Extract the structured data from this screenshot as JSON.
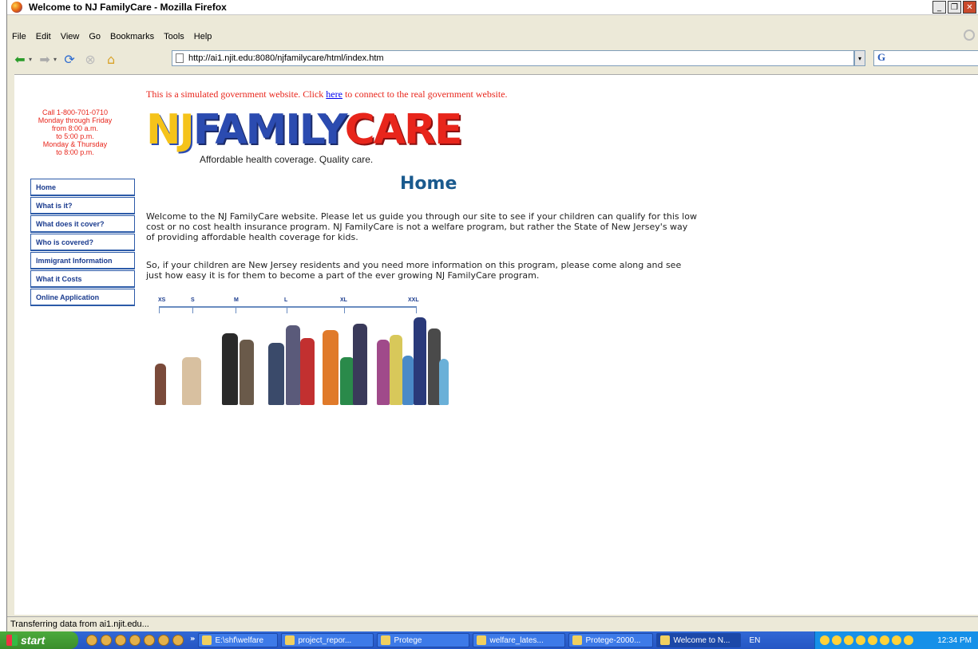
{
  "window": {
    "title": "Welcome to NJ FamilyCare - Mozilla Firefox"
  },
  "menu": [
    "File",
    "Edit",
    "View",
    "Go",
    "Bookmarks",
    "Tools",
    "Help"
  ],
  "nav": {
    "url": "http://ai1.njit.edu:8080/njfamilycare/html/index.htm"
  },
  "page": {
    "notice_before": "This is a simulated government website. Click ",
    "notice_link": "here",
    "notice_after": " to connect to the real government website.",
    "call_lines": [
      "Call 1-800-701-0710",
      "Monday through Friday",
      "from 8:00 a.m.",
      "to 5:00 p.m.",
      "Monday & Thursday",
      "to 8:00 p.m."
    ],
    "logo": {
      "nj": "NJ",
      "family": "FAMILY",
      "care": "CARE",
      "tagline": "Affordable health coverage. Quality care."
    },
    "sidebar": [
      "Home",
      "What is it?",
      "What does it cover?",
      "Who is covered?",
      "Immigrant Information",
      "What it Costs",
      "Online Application"
    ],
    "heading": "Home",
    "para1": "Welcome to the NJ FamilyCare website. Please let us guide you through our site to see if your children can qualify for this low cost or no cost health insurance program. NJ FamilyCare is not a welfare program, but rather the State of New Jersey's way of providing affordable health coverage for kids.",
    "para2": "So, if your children are New Jersey residents and you need more information on this program, please come along and see just how easy it is for them to become a part of the ever growing NJ FamilyCare program.",
    "sizes": [
      "XS",
      "S",
      "M",
      "L",
      "XL",
      "XXL"
    ]
  },
  "status": "Transferring data from ai1.njit.edu...",
  "taskbar": {
    "start": "start",
    "tasks": [
      "E:\\shf\\welfare",
      "project_repor...",
      "Protege",
      "welfare_lates...",
      "Protege-2000...",
      "Welcome to N..."
    ],
    "lang": "EN",
    "clock": "12:34 PM"
  }
}
